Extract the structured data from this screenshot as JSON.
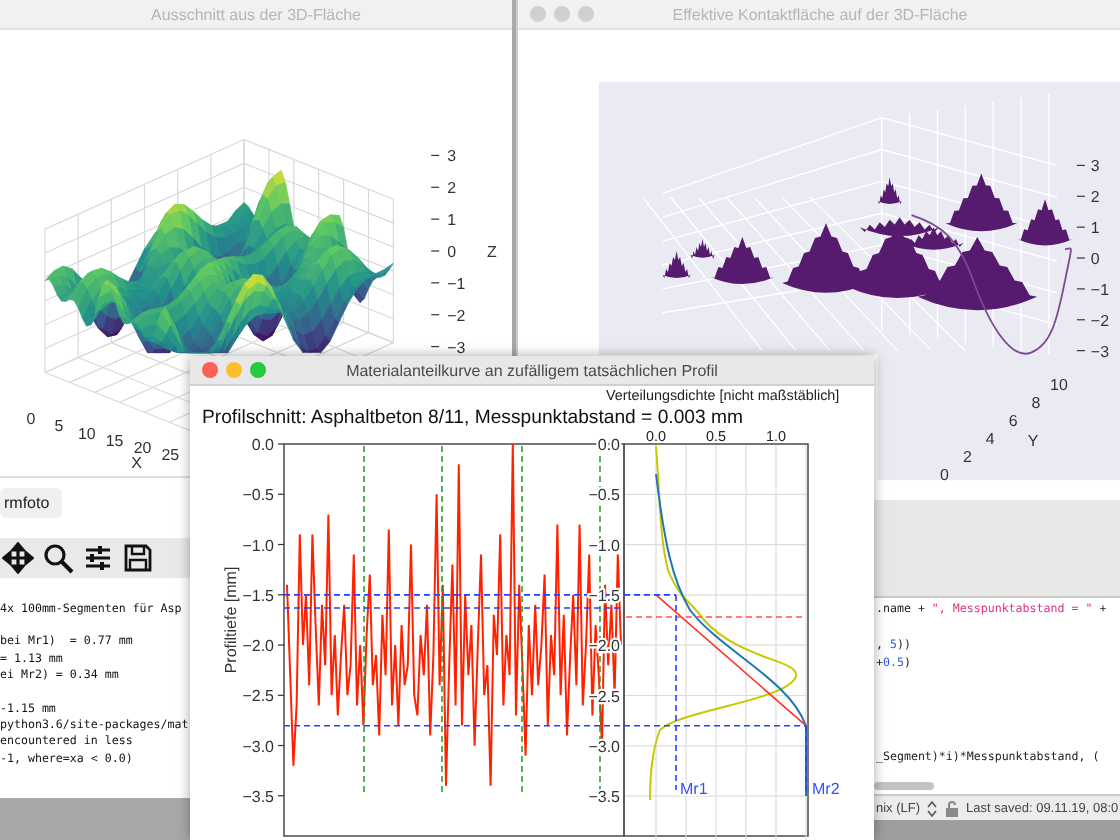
{
  "surface_window": {
    "title": "Ausschnitt aus der 3D-Fläche",
    "active": false,
    "z_axis": {
      "label": "Z",
      "ticks": [
        "3",
        "2",
        "1",
        "0",
        "−1",
        "−2",
        "−3"
      ]
    },
    "x_axis": {
      "label": "X",
      "ticks": [
        "0",
        "5",
        "10",
        "15",
        "20",
        "25"
      ]
    }
  },
  "contact_window": {
    "title": "Effektive Kontaktfläche auf der 3D-Fläche",
    "active": false,
    "z_axis": {
      "ticks": [
        "3",
        "2",
        "1",
        "0",
        "−1",
        "−2",
        "−3"
      ]
    },
    "y_axis": {
      "label": "Y",
      "ticks": [
        "10",
        "8",
        "6",
        "4",
        "2",
        "0"
      ]
    }
  },
  "console_window": {
    "button": "rmfoto",
    "blocks": [
      {
        "lines": [
          "4x 100mm-Segmenten für Asp"
        ]
      },
      {
        "lines": [
          "bei Mr1)  = 0.77 mm",
          "= 1.13 mm",
          "ei Mr2) = 0.34 mm"
        ]
      },
      {
        "lines": [
          "-1.15 mm",
          "python3.6/site-packages/mat",
          "encountered in less",
          "-1, where=xa < 0.0)"
        ]
      }
    ]
  },
  "editor_window": {
    "code_blocks": [
      {
        "lines": [
          [
            {
              "text": ".name + ",
              "kind": "plain"
            },
            {
              "text": "\", Messpunktabstand = \"",
              "kind": "string"
            },
            {
              "text": " +",
              "kind": "plain"
            }
          ]
        ]
      },
      {
        "lines": [
          [
            {
              "text": ", ",
              "kind": "plain"
            },
            {
              "text": "5",
              "kind": "number"
            },
            {
              "text": "))",
              "kind": "plain"
            }
          ],
          [
            {
              "text": "+",
              "kind": "plain"
            },
            {
              "text": "0.5",
              "kind": "number"
            },
            {
              "text": ")",
              "kind": "plain"
            }
          ]
        ]
      },
      {
        "lines": [
          [
            {
              "text": "_Segment)*i)*Messpunktabstand, (",
              "kind": "plain"
            }
          ]
        ]
      }
    ],
    "line_ending": "nix (LF)",
    "last_saved": "Last saved: 09.11.19, 08:0"
  },
  "profile_window": {
    "title": "Materialanteilkurve an zufälligem tatsächlichen Profil",
    "active": true,
    "figure_title": "Profilschnitt: Asphaltbeton 8/11, Messpunktabstand = 0.003 mm",
    "profile_plot": {
      "chart_data": {
        "type": "line",
        "ylabel": "Profiltiefe [mm]",
        "ylim": [
          -3.9,
          0
        ],
        "yticks": [
          {
            "value": 0,
            "label": "0.0"
          },
          {
            "value": -0.5,
            "label": "−0.5"
          },
          {
            "value": -1,
            "label": "−1.0"
          },
          {
            "value": -1.5,
            "label": "−1.5"
          },
          {
            "value": -2,
            "label": "−2.0"
          },
          {
            "value": -2.5,
            "label": "−2.5"
          },
          {
            "value": -3,
            "label": "−3.0"
          },
          {
            "value": -3.5,
            "label": "−3.5"
          }
        ],
        "series": [
          {
            "color": "#ff2200",
            "values": [
              -1.4,
              -2.3,
              -3.2,
              -2.6,
              -0.9,
              -2.0,
              -1.5,
              -2.4,
              -0.9,
              -1.8,
              -2.6,
              -1.6,
              -2.2,
              -0.7,
              -2.5,
              -1.9,
              -2.7,
              -2.1,
              -1.6,
              -2.5,
              -2.2,
              -1.1,
              -2.6,
              -2.0,
              -2.8,
              -1.9,
              -1.3,
              -2.4,
              -2.1,
              -2.9,
              -1.7,
              -2.3,
              -0.85,
              -2.6,
              -2.0,
              -2.8,
              -1.8,
              -2.4,
              -2.2,
              -1.0,
              -2.5,
              -2.7,
              -1.9,
              -2.3,
              -1.6,
              -2.9,
              -2.1,
              -0.5,
              -2.4,
              -1.4,
              -3.4,
              -2.2,
              -1.2,
              -2.6,
              -0.2,
              -2.8,
              -1.5,
              -2.3,
              -1.8,
              -3.0,
              -2.0,
              -1.1,
              -2.5,
              -2.2,
              -3.4,
              -1.7,
              -2.1,
              -0.9,
              -2.6,
              -1.9,
              -2.3,
              0.0,
              -2.7,
              -1.4,
              -2.2,
              -3.1,
              -1.8,
              -2.5,
              -1.6,
              -2.4,
              -2.0,
              -1.3,
              -2.8,
              -1.9,
              -2.3,
              -0.8,
              -2.5,
              -1.7,
              -2.9,
              -2.1,
              -1.5,
              -2.4,
              -0.8,
              -2.6,
              -2.0,
              -1.1,
              -2.7,
              -1.8,
              -2.3,
              -3.0,
              -1.4,
              -2.2,
              -1.6,
              -2.5,
              -1.1,
              -2.0
            ]
          }
        ]
      }
    },
    "density_plot": {
      "title": "Verteilungsdichte [nicht maßstäblich]",
      "xticks": [
        "0.0",
        "0.5",
        "1.0"
      ],
      "yticks": [
        "0.0",
        "−0.5",
        "−1.0",
        "−1.5",
        "−2.0",
        "−2.5",
        "−3.0",
        "−3.5"
      ],
      "markers": [
        "Mr1",
        "Mr2"
      ]
    }
  }
}
